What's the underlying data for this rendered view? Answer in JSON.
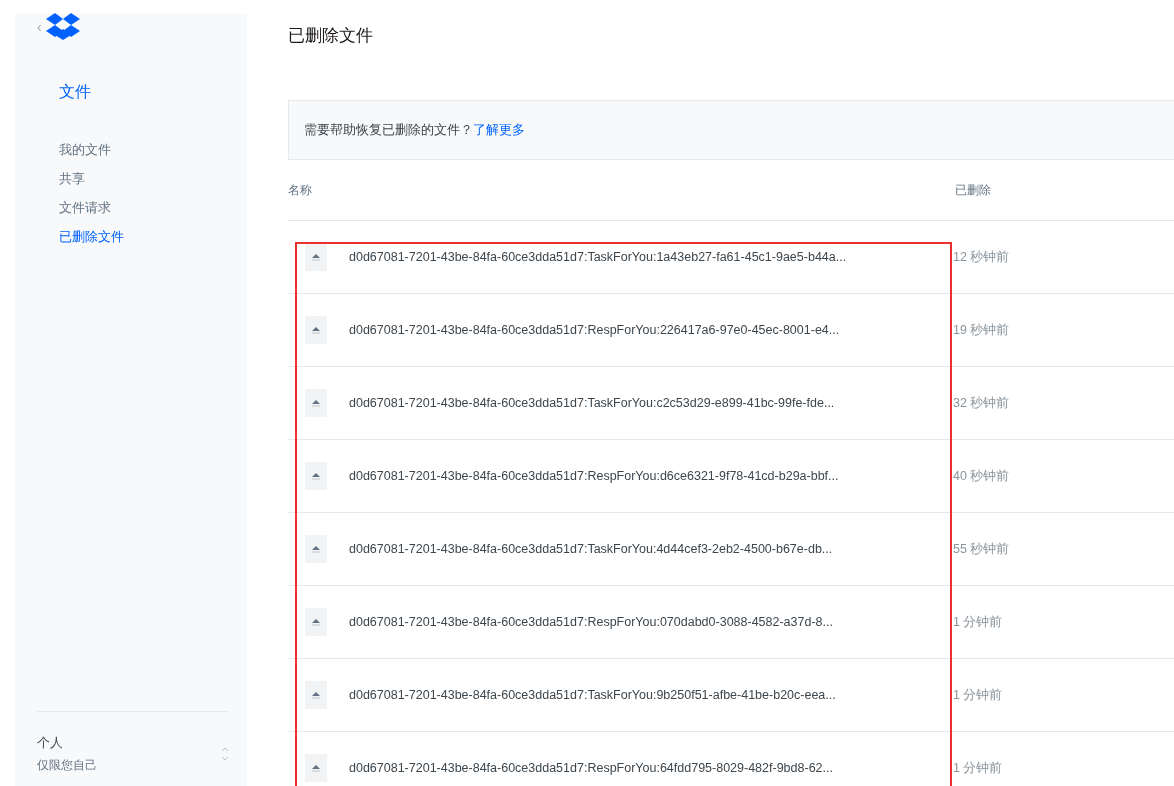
{
  "sidebar": {
    "back": "‹",
    "section_title": "文件",
    "items": [
      {
        "label": "我的文件",
        "selected": false
      },
      {
        "label": "共享",
        "selected": false
      },
      {
        "label": "文件请求",
        "selected": false
      },
      {
        "label": "已删除文件",
        "selected": true
      }
    ],
    "account": {
      "name": "个人",
      "subtitle": "仅限您自己"
    }
  },
  "page_title": "已删除文件",
  "banner": {
    "text": "需要帮助恢复已删除的文件？",
    "link": "了解更多"
  },
  "table": {
    "columns": [
      "名称",
      "已删除"
    ],
    "rows": [
      {
        "name": "d0d67081-7201-43be-84fa-60ce3dda51d7:TaskForYou:1a43eb27-fa61-45c1-9ae5-b44a...",
        "deleted": "12 秒钟前"
      },
      {
        "name": "d0d67081-7201-43be-84fa-60ce3dda51d7:RespForYou:226417a6-97e0-45ec-8001-e4...",
        "deleted": "19 秒钟前"
      },
      {
        "name": "d0d67081-7201-43be-84fa-60ce3dda51d7:TaskForYou:c2c53d29-e899-41bc-99fe-fde...",
        "deleted": "32 秒钟前"
      },
      {
        "name": "d0d67081-7201-43be-84fa-60ce3dda51d7:RespForYou:d6ce6321-9f78-41cd-b29a-bbf...",
        "deleted": "40 秒钟前"
      },
      {
        "name": "d0d67081-7201-43be-84fa-60ce3dda51d7:TaskForYou:4d44cef3-2eb2-4500-b67e-db...",
        "deleted": "55 秒钟前"
      },
      {
        "name": "d0d67081-7201-43be-84fa-60ce3dda51d7:RespForYou:070dabd0-3088-4582-a37d-8...",
        "deleted": "1 分钟前"
      },
      {
        "name": "d0d67081-7201-43be-84fa-60ce3dda51d7:TaskForYou:9b250f51-afbe-41be-b20c-eea...",
        "deleted": "1 分钟前"
      },
      {
        "name": "d0d67081-7201-43be-84fa-60ce3dda51d7:RespForYou:64fdd795-8029-482f-9bd8-62...",
        "deleted": "1 分钟前"
      }
    ]
  }
}
